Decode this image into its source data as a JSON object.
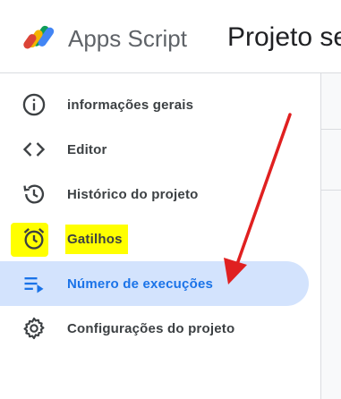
{
  "header": {
    "app_name": "Apps Script",
    "project_title": "Projeto se"
  },
  "nav": {
    "items": [
      {
        "label": "informações gerais",
        "icon": "info-icon"
      },
      {
        "label": "Editor",
        "icon": "code-icon"
      },
      {
        "label": "Histórico do projeto",
        "icon": "history-icon"
      },
      {
        "label": "Gatilhos",
        "icon": "alarm-clock-icon"
      },
      {
        "label": "Número de execuções",
        "icon": "executions-icon"
      },
      {
        "label": "Configurações do projeto",
        "icon": "gear-icon"
      }
    ]
  },
  "colors": {
    "active_bg": "#d3e3fd",
    "active_text": "#1a73e8",
    "highlight": "#ffff00",
    "annotation_arrow": "#e02020"
  }
}
